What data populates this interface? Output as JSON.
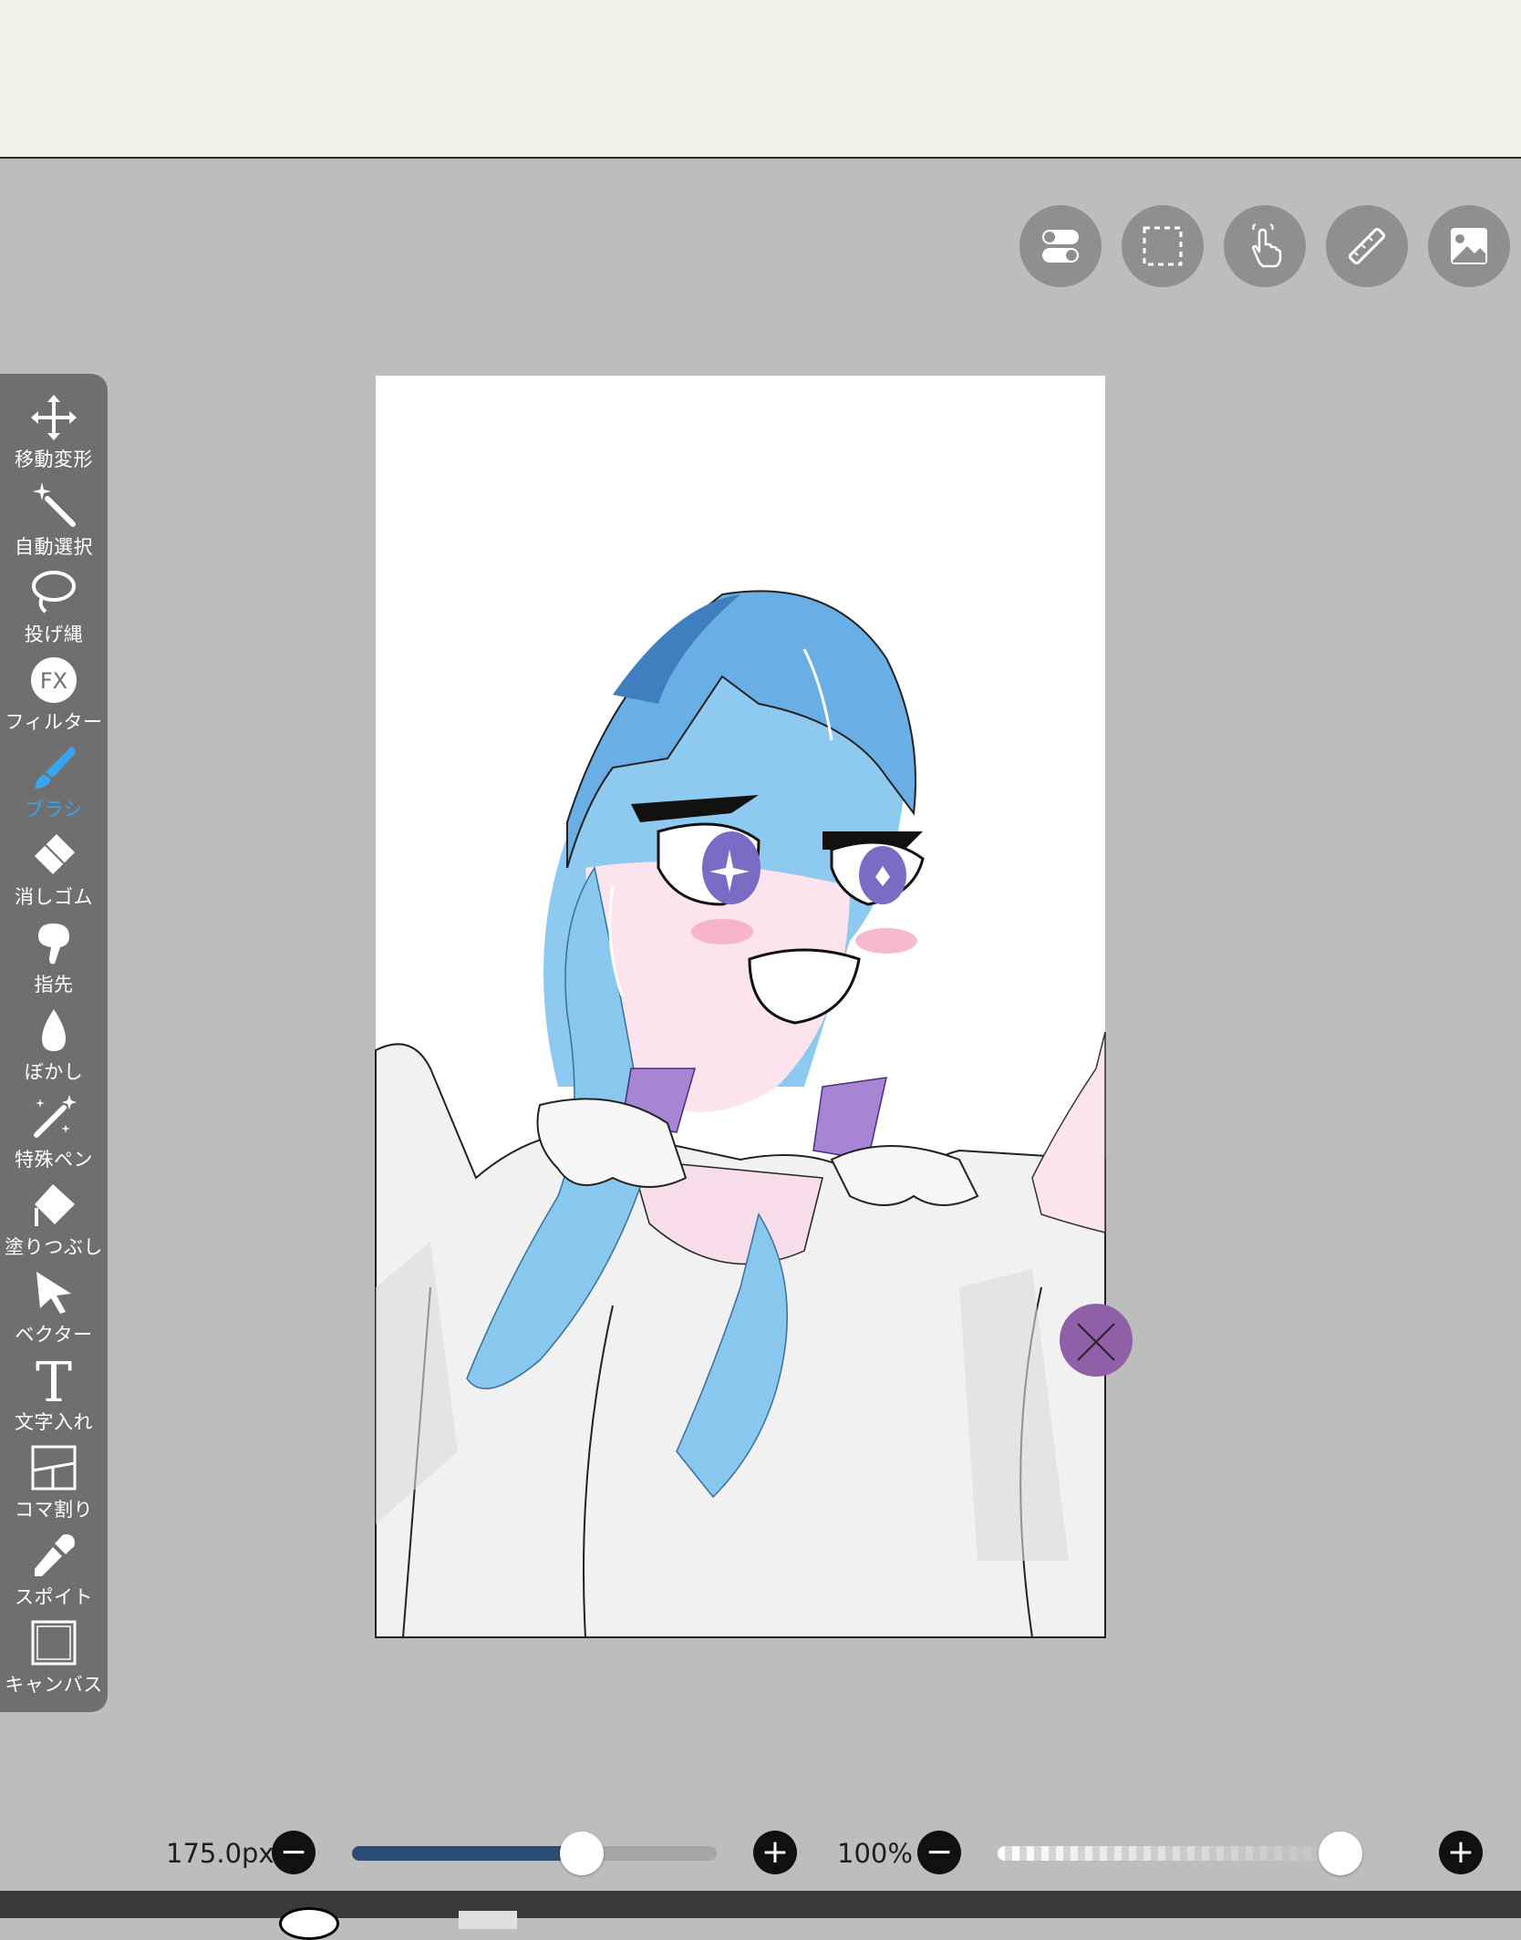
{
  "top_buttons": [
    {
      "icon": "toggle-settings-icon"
    },
    {
      "icon": "selection-icon"
    },
    {
      "icon": "hand-gesture-icon"
    },
    {
      "icon": "ruler-icon"
    },
    {
      "icon": "image-layer-icon"
    }
  ],
  "toolbar": {
    "tools": [
      {
        "label": "移動変形",
        "icon": "move-transform-icon"
      },
      {
        "label": "自動選択",
        "icon": "magic-wand-icon"
      },
      {
        "label": "投げ縄",
        "icon": "lasso-icon"
      },
      {
        "label": "フィルター",
        "icon": "fx-filter-icon"
      },
      {
        "label": "ブラシ",
        "icon": "brush-icon"
      },
      {
        "label": "消しゴム",
        "icon": "eraser-icon"
      },
      {
        "label": "指先",
        "icon": "finger-smudge-icon"
      },
      {
        "label": "ぼかし",
        "icon": "blur-drop-icon"
      },
      {
        "label": "特殊ペン",
        "icon": "special-pen-icon"
      },
      {
        "label": "塗りつぶし",
        "icon": "fill-bucket-icon"
      },
      {
        "label": "ベクター",
        "icon": "vector-arrow-icon"
      },
      {
        "label": "文字入れ",
        "icon": "text-icon"
      },
      {
        "label": "コマ割り",
        "icon": "panel-divide-icon"
      },
      {
        "label": "スポイト",
        "icon": "eyedropper-icon"
      },
      {
        "label": "キャンバス",
        "icon": "canvas-icon"
      }
    ],
    "active_index": 4,
    "accent_color": "#3aa3f0"
  },
  "fx_text": "FX",
  "text_tool_glyph": "T",
  "brush": {
    "size_label": "175.0px",
    "size_fraction": 0.63,
    "opacity_label": "100%",
    "opacity_fraction": 1.0,
    "minus": "−",
    "plus": "+"
  }
}
